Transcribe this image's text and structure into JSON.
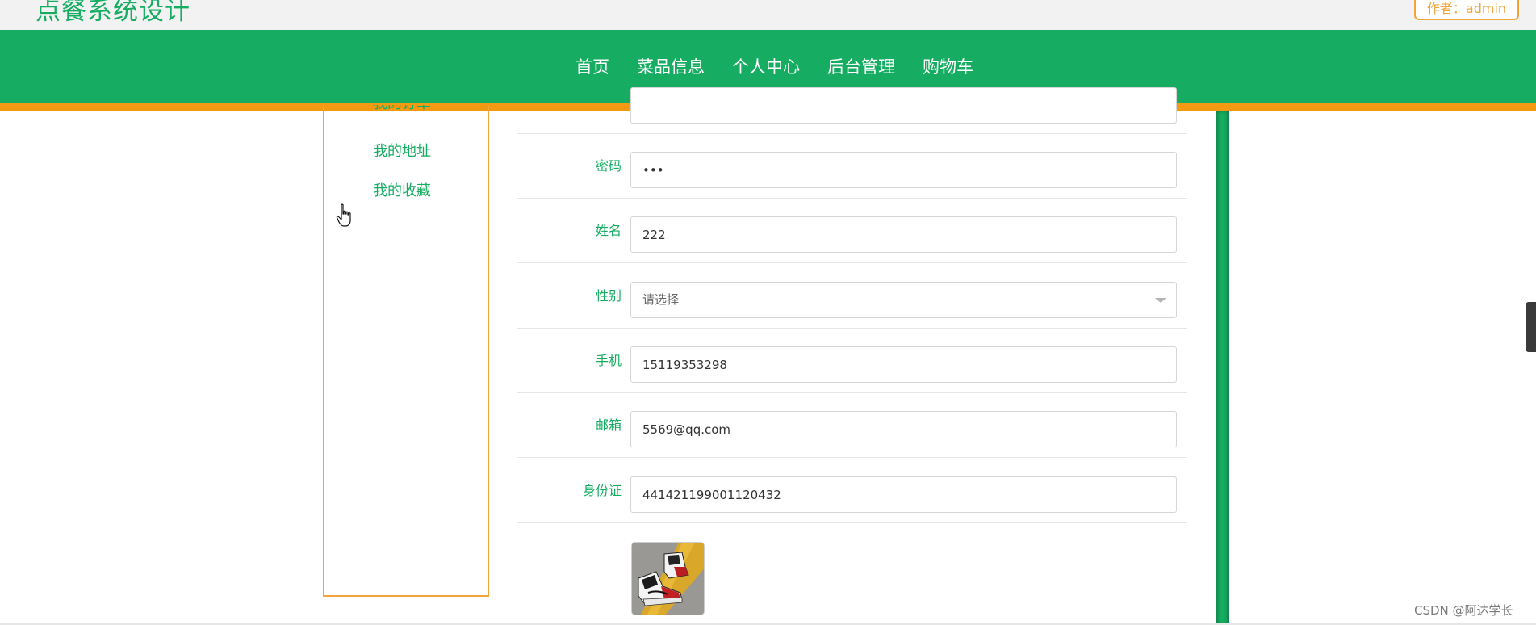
{
  "header": {
    "site_title": "点餐系统设计",
    "author_badge": "作者：admin"
  },
  "nav": {
    "items": [
      "首页",
      "菜品信息",
      "个人中心",
      "后台管理",
      "购物车"
    ]
  },
  "sidebar": {
    "items": [
      "我的订单",
      "我的地址",
      "我的收藏"
    ]
  },
  "form": {
    "password": {
      "label": "密码",
      "value": "•••"
    },
    "name": {
      "label": "姓名",
      "value": "222"
    },
    "gender": {
      "label": "性别",
      "placeholder": "请选择"
    },
    "phone": {
      "label": "手机",
      "value": "15119353298"
    },
    "email": {
      "label": "邮箱",
      "value": "5569@qq.com"
    },
    "id_card": {
      "label": "身份证",
      "value": "441421199001120432"
    }
  },
  "watermark": "CSDN @阿达学长",
  "colors": {
    "primary_green": "#16ad62",
    "accent_orange": "#f39a12",
    "badge_orange": "#f0a43a"
  },
  "icons": [
    "hand-pointer-cursor-icon",
    "chevron-down-icon"
  ]
}
